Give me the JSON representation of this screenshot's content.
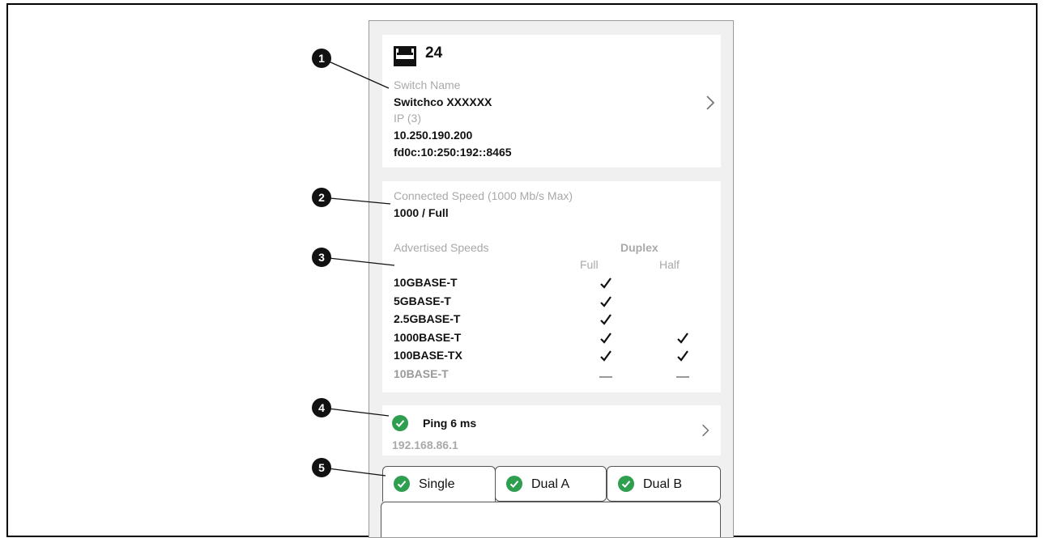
{
  "callouts": [
    "1",
    "2",
    "3",
    "4",
    "5"
  ],
  "port": {
    "number": "24",
    "icon": "ethernet-port-icon"
  },
  "switch_info": {
    "name_label": "Switch Name",
    "name_value": "Switchco XXXXXX",
    "ip_label": "IP (3)",
    "ip_v4": "10.250.190.200",
    "ip_v6": "fd0c:10:250:192::8465"
  },
  "speed": {
    "connected_label": "Connected Speed (1000 Mb/s Max)",
    "connected_value": "1000 / Full",
    "advertised_label": "Advertised Speeds",
    "duplex_label": "Duplex",
    "full_label": "Full",
    "half_label": "Half",
    "rows": [
      {
        "name": "10GBASE-T",
        "full": "check",
        "half": "none"
      },
      {
        "name": "5GBASE-T",
        "full": "check",
        "half": "none"
      },
      {
        "name": "2.5GBASE-T",
        "full": "check",
        "half": "none"
      },
      {
        "name": "1000BASE-T",
        "full": "check",
        "half": "check"
      },
      {
        "name": "100BASE-TX",
        "full": "check",
        "half": "check"
      },
      {
        "name": "10BASE-T",
        "full": "dash",
        "half": "dash"
      }
    ]
  },
  "ping": {
    "label": "Ping 6 ms",
    "address": "192.168.86.1",
    "status_color": "#2e9e4f"
  },
  "tabs": [
    {
      "label": "Single",
      "status": "pass"
    },
    {
      "label": "Dual A",
      "status": "pass"
    },
    {
      "label": "Dual B",
      "status": "pass"
    }
  ],
  "colors": {
    "pass": "#2e9e4f",
    "muted_text": "#a9a9a9",
    "panel_bg": "#f0f0f0"
  }
}
